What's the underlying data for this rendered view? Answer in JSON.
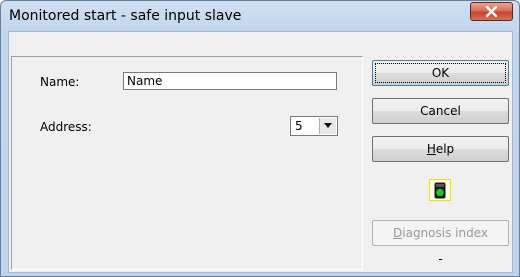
{
  "window": {
    "title": "Monitored start - safe input slave",
    "close_icon": "close-x-icon"
  },
  "form": {
    "name_label": "Name:",
    "name_value": "Name",
    "address_label": "Address:",
    "address_value": "5"
  },
  "buttons": {
    "ok": "OK",
    "cancel": "Cancel",
    "help_pre": "",
    "help_ul": "H",
    "help_post": "elp",
    "diag_pre": "",
    "diag_ul": "D",
    "diag_post": "iagnosis index"
  },
  "status": {
    "led_icon": "green-led-icon",
    "led_color": "#22c22a",
    "diagnosis_value": "-"
  }
}
